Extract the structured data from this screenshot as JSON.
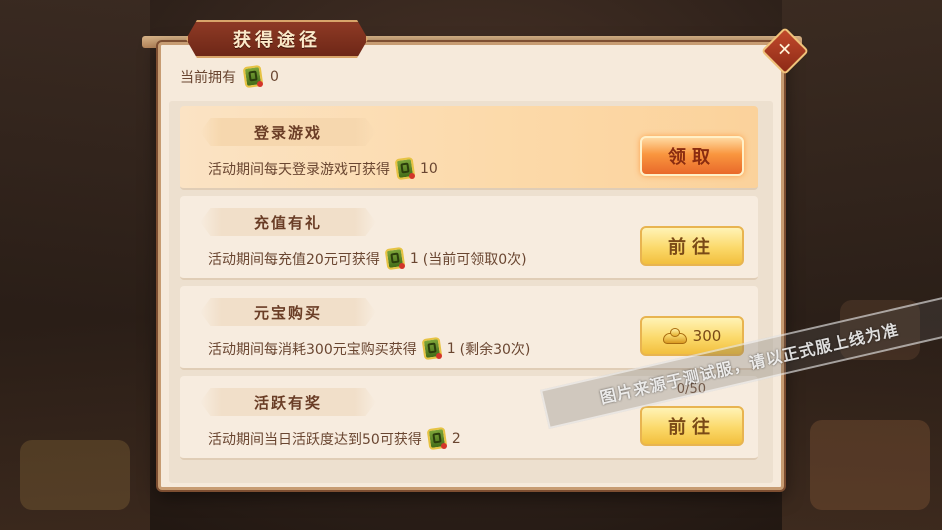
{
  "dialog": {
    "title": "获得途径",
    "close_label": "✕"
  },
  "owned": {
    "label": "当前拥有",
    "count": "0"
  },
  "tasks": [
    {
      "title": "登录游戏",
      "desc": "活动期间每天登录游戏可获得",
      "reward": "10",
      "suffix": "",
      "button": "领取",
      "button_type": "claim"
    },
    {
      "title": "充值有礼",
      "desc": "活动期间每充值20元可获得",
      "reward": "1",
      "suffix": "(当前可领取0次)",
      "button": "前往",
      "button_type": "go"
    },
    {
      "title": "元宝购买",
      "desc": "活动期间每消耗300元宝购买获得",
      "reward": "1",
      "suffix": "(剩余30次)",
      "button": "300",
      "button_type": "buy",
      "button_icon": "gold-ingot-icon"
    },
    {
      "title": "活跃有奖",
      "desc": "活动期间当日活跃度达到50可获得",
      "reward": "2",
      "suffix": "",
      "button": "前往",
      "button_type": "go",
      "progress": "0/50"
    }
  ],
  "watermark": "图片来源于测试服，请以正式服上线为准",
  "icons": {
    "currency": "green-token-icon",
    "close": "close-icon"
  },
  "colors": {
    "panel_bg": "#f6eadb",
    "title_plate": "#8e3a25",
    "claim_button": "#f9963f",
    "go_button": "#fbd96a",
    "text": "#6a4631"
  }
}
